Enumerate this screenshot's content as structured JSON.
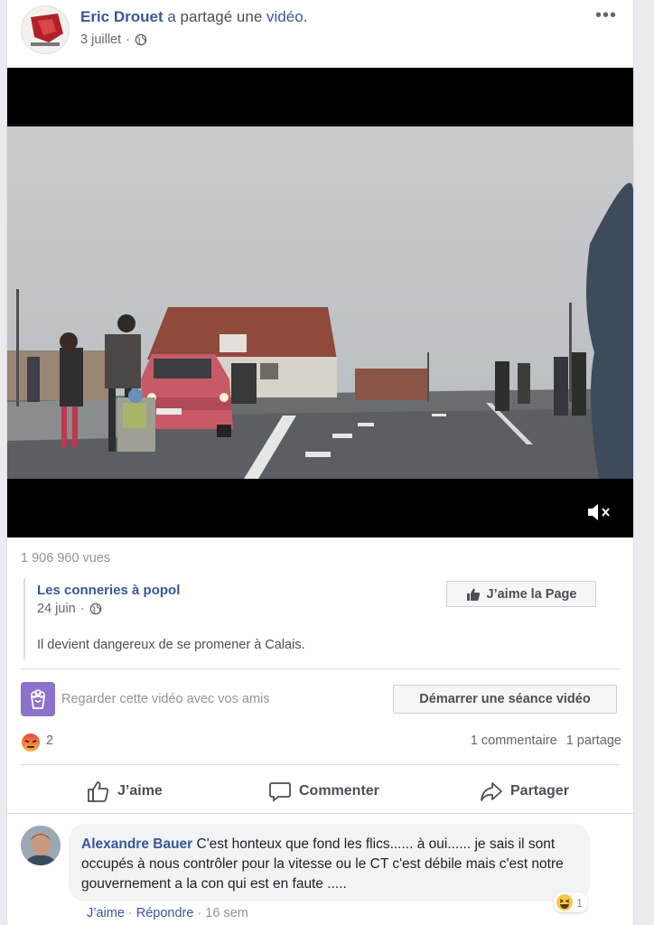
{
  "post": {
    "author": "Eric Drouet",
    "action_text": "a partagé une",
    "object_link": "vidéo",
    "object_suffix": ".",
    "date": "3 juillet",
    "dot": "·",
    "more": "•••",
    "views": "1 906 960 vues"
  },
  "shared": {
    "page_name": "Les conneries à popol",
    "date": "24 juin",
    "dot": "·",
    "text": "Il devient dangereux de se promener à Calais.",
    "like_page_label": "J’aime la Page"
  },
  "watch_party": {
    "text": "Regarder cette vidéo avec vos amis",
    "button": "Démarrer une séance vidéo"
  },
  "stats": {
    "reaction_count": "2",
    "comments": "1 commentaire",
    "shares": "1 partage"
  },
  "actions": {
    "like": "J’aime",
    "comment": "Commenter",
    "share": "Partager"
  },
  "comment": {
    "author": "Alexandre Bauer",
    "text": "C'est honteux que fond les flics...... à oui...... je sais il sont occupés à nous contrôler pour la vitesse ou le CT c'est débile mais c'est notre gouvernement a la con qui est en faute .....",
    "reaction_count": "1",
    "like": "J’aime",
    "reply": "Répondre",
    "age": "16 sem",
    "dot": "·"
  },
  "colors": {
    "link": "#385898",
    "secondary_text": "#606770",
    "watch_icon_bg": "#8c72cb",
    "card_bg": "#ffffff",
    "page_bg": "#e9ebee"
  },
  "icons": {
    "privacy": "globe-icon",
    "video_sound": "muted-speaker-icon",
    "like_page": "thumbs-up-icon",
    "watch": "popcorn-icon",
    "reaction": "angry-face-icon",
    "comment_reaction": "laughing-face-icon"
  }
}
